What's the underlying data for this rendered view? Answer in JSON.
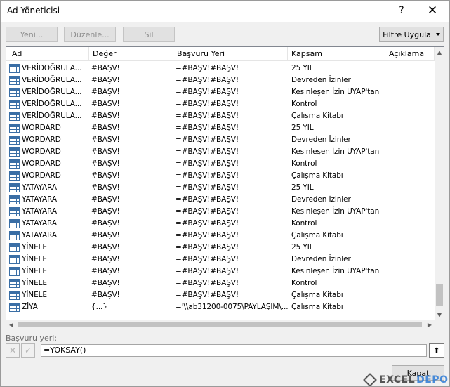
{
  "window": {
    "title": "Ad Yöneticisi",
    "help": "?",
    "close": "✕"
  },
  "toolbar": {
    "new_label": "Yeni...",
    "edit_label": "Düzenle...",
    "delete_label": "Sil",
    "filter_label": "Filtre Uygula"
  },
  "table": {
    "columns": [
      "Ad",
      "Değer",
      "Başvuru Yeri",
      "Kapsam",
      "Açıklama"
    ],
    "rows": [
      {
        "name": "VERİDOĞRULA...",
        "value": "#BAŞV!",
        "refers": "=#BAŞV!#BAŞV!",
        "scope": "25 YIL"
      },
      {
        "name": "VERİDOĞRULA...",
        "value": "#BAŞV!",
        "refers": "=#BAŞV!#BAŞV!",
        "scope": "Devreden İzinler"
      },
      {
        "name": "VERİDOĞRULA...",
        "value": "#BAŞV!",
        "refers": "=#BAŞV!#BAŞV!",
        "scope": "Kesinleşen İzin UYAP'tan"
      },
      {
        "name": "VERİDOĞRULA...",
        "value": "#BAŞV!",
        "refers": "=#BAŞV!#BAŞV!",
        "scope": "Kontrol"
      },
      {
        "name": "VERİDOĞRULA...",
        "value": "#BAŞV!",
        "refers": "=#BAŞV!#BAŞV!",
        "scope": "Çalışma Kitabı"
      },
      {
        "name": "WORDARD",
        "value": "#BAŞV!",
        "refers": "=#BAŞV!#BAŞV!",
        "scope": "25 YIL"
      },
      {
        "name": "WORDARD",
        "value": "#BAŞV!",
        "refers": "=#BAŞV!#BAŞV!",
        "scope": "Devreden İzinler"
      },
      {
        "name": "WORDARD",
        "value": "#BAŞV!",
        "refers": "=#BAŞV!#BAŞV!",
        "scope": "Kesinleşen İzin UYAP'tan"
      },
      {
        "name": "WORDARD",
        "value": "#BAŞV!",
        "refers": "=#BAŞV!#BAŞV!",
        "scope": "Kontrol"
      },
      {
        "name": "WORDARD",
        "value": "#BAŞV!",
        "refers": "=#BAŞV!#BAŞV!",
        "scope": "Çalışma Kitabı"
      },
      {
        "name": "YATAYARA",
        "value": "#BAŞV!",
        "refers": "=#BAŞV!#BAŞV!",
        "scope": "25 YIL"
      },
      {
        "name": "YATAYARA",
        "value": "#BAŞV!",
        "refers": "=#BAŞV!#BAŞV!",
        "scope": "Devreden İzinler"
      },
      {
        "name": "YATAYARA",
        "value": "#BAŞV!",
        "refers": "=#BAŞV!#BAŞV!",
        "scope": "Kesinleşen İzin UYAP'tan"
      },
      {
        "name": "YATAYARA",
        "value": "#BAŞV!",
        "refers": "=#BAŞV!#BAŞV!",
        "scope": "Kontrol"
      },
      {
        "name": "YATAYARA",
        "value": "#BAŞV!",
        "refers": "=#BAŞV!#BAŞV!",
        "scope": "Çalışma Kitabı"
      },
      {
        "name": "YİNELE",
        "value": "#BAŞV!",
        "refers": "=#BAŞV!#BAŞV!",
        "scope": "25 YIL"
      },
      {
        "name": "YİNELE",
        "value": "#BAŞV!",
        "refers": "=#BAŞV!#BAŞV!",
        "scope": "Devreden İzinler"
      },
      {
        "name": "YİNELE",
        "value": "#BAŞV!",
        "refers": "=#BAŞV!#BAŞV!",
        "scope": "Kesinleşen İzin UYAP'tan"
      },
      {
        "name": "YİNELE",
        "value": "#BAŞV!",
        "refers": "=#BAŞV!#BAŞV!",
        "scope": "Kontrol"
      },
      {
        "name": "YİNELE",
        "value": "#BAŞV!",
        "refers": "=#BAŞV!#BAŞV!",
        "scope": "Çalışma Kitabı"
      },
      {
        "name": "ZİYA",
        "value": "{...}",
        "refers": "='\\\\ab31200-0075\\PAYLAŞIM\\...",
        "scope": "Çalışma Kitabı"
      }
    ]
  },
  "reference": {
    "label": "Başvuru yeri:",
    "value": "=YOKSAY()"
  },
  "footer": {
    "close_label": "Kapat"
  },
  "watermark": {
    "text_part1": "EXCEL",
    "text_part2": "DEPO"
  }
}
